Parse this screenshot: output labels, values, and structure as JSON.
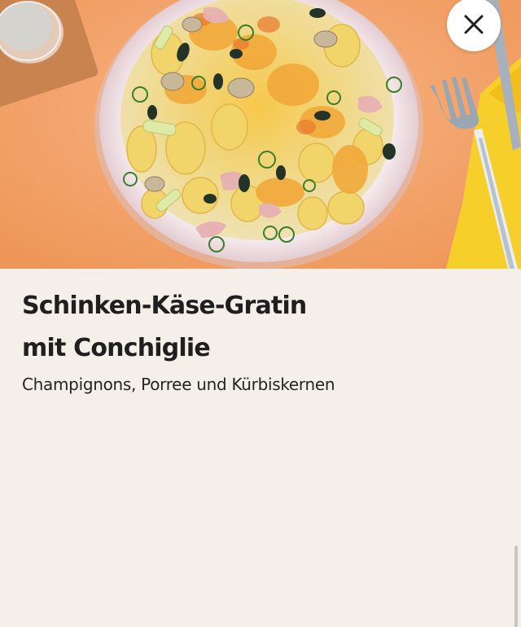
{
  "recipe": {
    "title_line1": "Schinken-Käse-Gratin",
    "title_line2": "mit Conchiglie",
    "subtitle": "Champignons, Porree und Kürbiskernen"
  },
  "icons": {
    "close": "close-icon"
  },
  "colors": {
    "background": "#f4efe8",
    "table": "#f3a36b",
    "napkin": "#f7cf2a",
    "text": "#1f1f1f"
  }
}
